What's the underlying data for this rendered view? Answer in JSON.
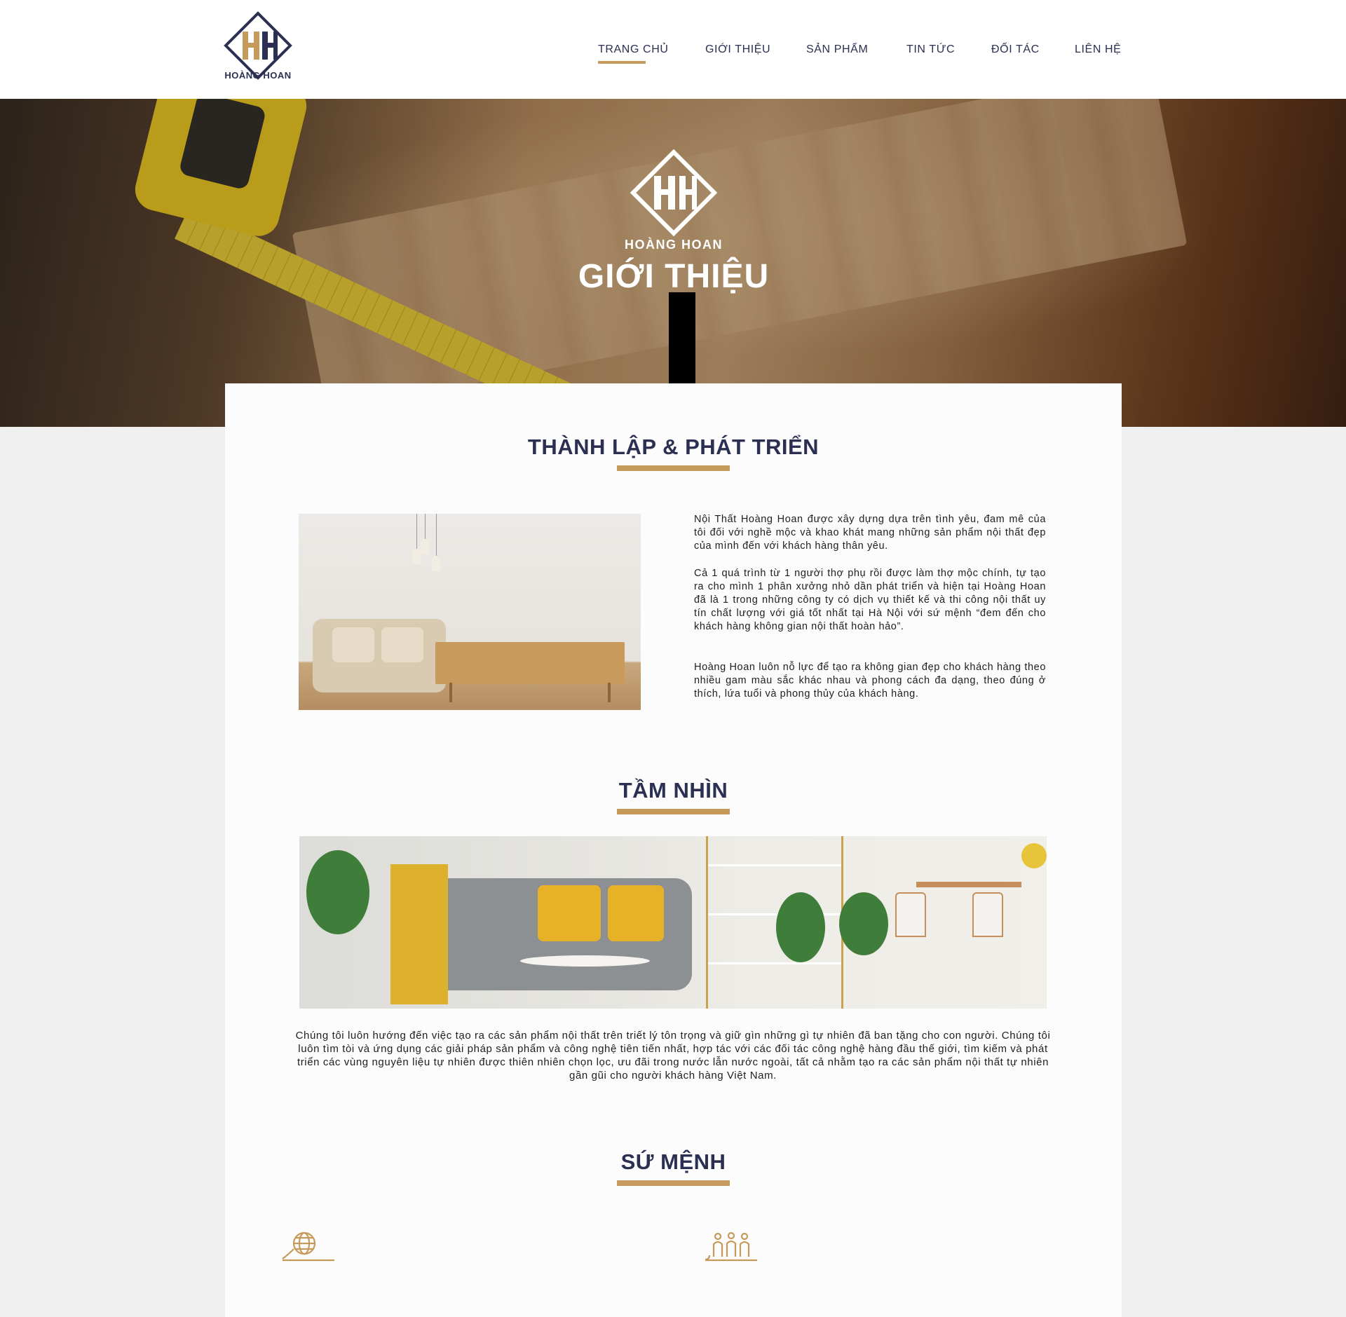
{
  "header": {
    "logo_text": "HOÀNG HOAN",
    "nav": [
      {
        "label": "TRANG CHỦ",
        "active": true
      },
      {
        "label": "GIỚI THIỆU",
        "active": false
      },
      {
        "label": "SẢN PHẨM",
        "active": false
      },
      {
        "label": "TIN TỨC",
        "active": false
      },
      {
        "label": "ĐỐI TÁC",
        "active": false
      },
      {
        "label": "LIÊN HỆ",
        "active": false
      }
    ]
  },
  "hero": {
    "brand": "HOÀNG HOAN",
    "title": "GIỚI THIỆU"
  },
  "sections": {
    "founding": {
      "title": "THÀNH LẬP & PHÁT TRIỂN",
      "paragraphs": [
        "Nội Thất Hoàng Hoan được xây dựng dựa trên tình yêu, đam mê của tôi đối với nghề mộc và khao khát mang những sản phẩm nội thất đẹp của mình đến với khách hàng thân yêu.",
        "Cả 1 quá trình từ 1 người thợ phụ rồi được làm thợ mộc chính, tự tạo ra cho mình 1 phân xưởng nhỏ dần phát triển và hiện tại Hoàng Hoan đã là 1 trong những công ty có dịch vụ thiết kế và thi công nội thất uy tín chất lượng với giá tốt nhất tại Hà Nội với sứ mệnh “đem đến cho khách hàng không gian nội thất hoàn hảo”.",
        "Hoàng Hoan luôn nỗ lực để tạo ra không gian đẹp cho khách hàng theo nhiều gam màu sắc khác nhau và phong cách đa dạng, theo đúng ở thích, lứa tuổi và phong thủy của khách hàng."
      ]
    },
    "vision": {
      "title": "TẦM NHÌN",
      "text": "Chúng tôi luôn hướng đến việc tạo ra các sản phẩm nội thất trên triết lý tôn trọng và giữ gìn những gì tự nhiên đã ban tặng cho con người. Chúng tôi luôn tìm tòi và ứng dụng các giải pháp sản phẩm và công nghệ tiên tiến nhất, hợp tác với các đối tác công nghệ hàng đầu thế giới, tìm kiếm và phát triển các vùng nguyên liệu tự nhiên được thiên nhiên chọn lọc, ưu đãi trong nước lẫn nước ngoài, tất cả nhằm tạo ra các sản phẩm nội thất tự nhiên gần gũi cho người khách hàng Việt Nam."
    },
    "mission": {
      "title": "SỨ MỆNH",
      "icons": [
        "globe-icon",
        "people-icon"
      ]
    }
  },
  "colors": {
    "navy": "#2b2f52",
    "gold": "#c59a5a",
    "background": "#f1f0f0",
    "card": "#fcfcfc"
  }
}
